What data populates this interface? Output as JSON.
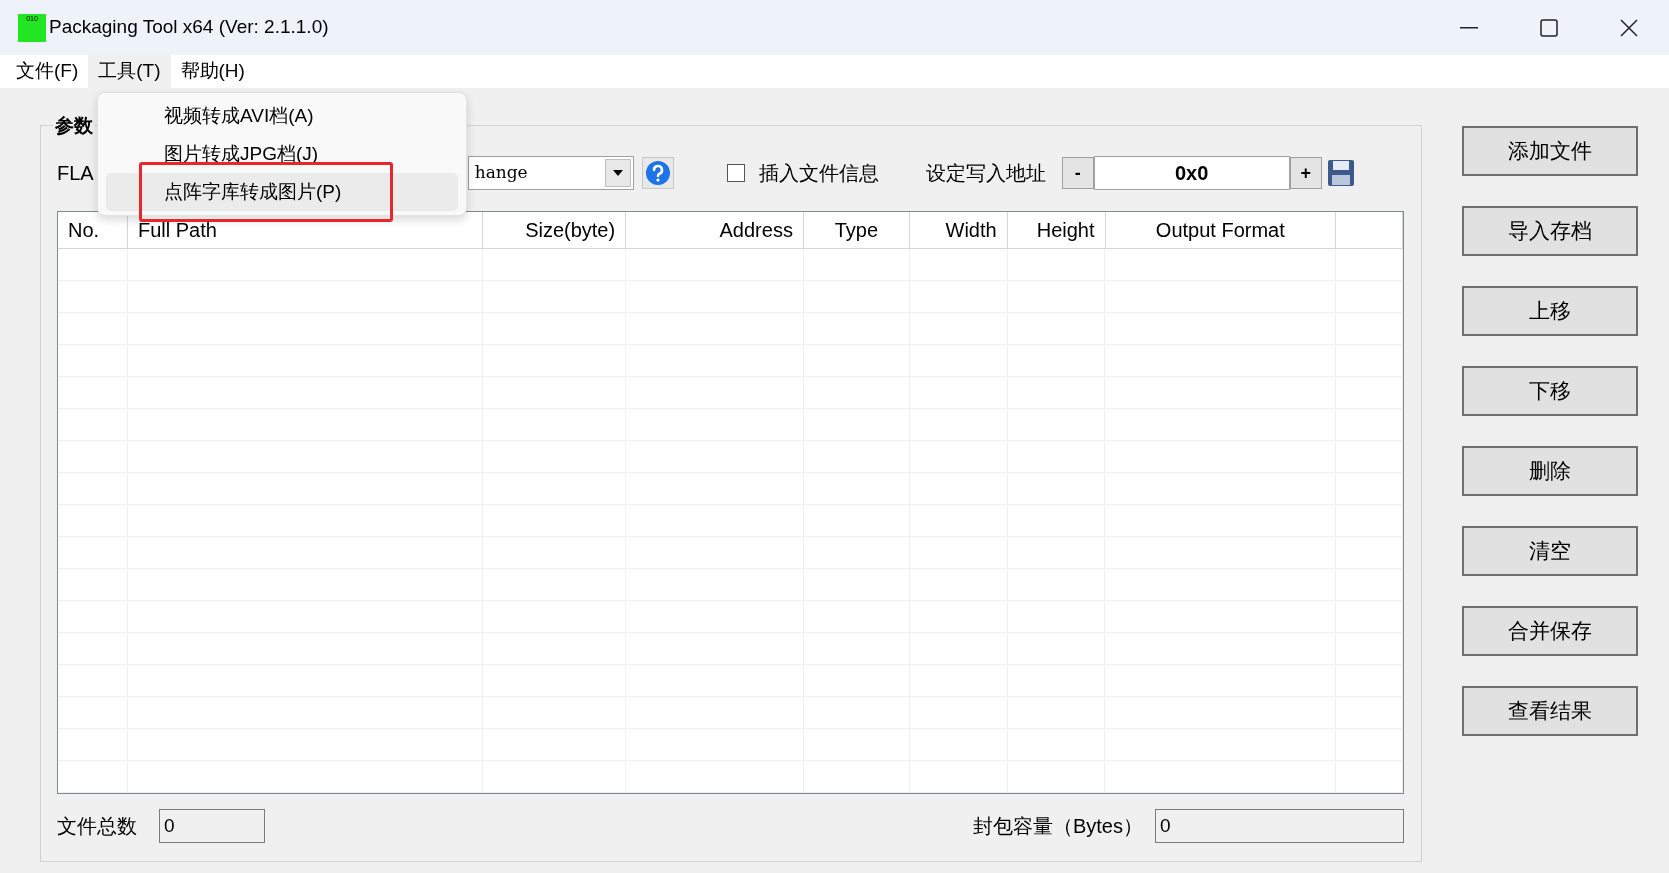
{
  "window": {
    "title": "Packaging Tool x64 (Ver: 2.1.1.0)",
    "app_icon_text": "010"
  },
  "menu_bar": [
    {
      "label": "文件(F)",
      "selected": false
    },
    {
      "label": "工具(T)",
      "selected": true
    },
    {
      "label": "帮助(H)",
      "selected": false
    }
  ],
  "dropdown_menu": {
    "items": [
      {
        "label": "视频转成AVI档(A)",
        "selected": false
      },
      {
        "label": "图片转成JPG档(J)",
        "selected": false
      },
      {
        "label": "点阵字库转成图片(P)",
        "selected": true
      }
    ]
  },
  "parameters": {
    "group_title": "参数",
    "row_label": "FLA",
    "combo_value": "hange",
    "insert_file_info": {
      "label": "插入文件信息",
      "checked": false
    },
    "address_label": "设定写入地址",
    "address_minus": "-",
    "address_value": "0x0",
    "address_plus": "+"
  },
  "table": {
    "columns": [
      {
        "label": "No."
      },
      {
        "label": "Full Path"
      },
      {
        "label": "Size(byte)"
      },
      {
        "label": "Address"
      },
      {
        "label": "Type"
      },
      {
        "label": "Width"
      },
      {
        "label": "Height"
      },
      {
        "label": "Output Format"
      }
    ]
  },
  "footer": {
    "file_count_label": "文件总数",
    "file_count_value": "0",
    "capacity_label": "封包容量（Bytes）",
    "capacity_value": "0"
  },
  "buttons": [
    "添加文件",
    "导入存档",
    "上移",
    "下移",
    "删除",
    "清空",
    "合并保存",
    "查看结果"
  ]
}
